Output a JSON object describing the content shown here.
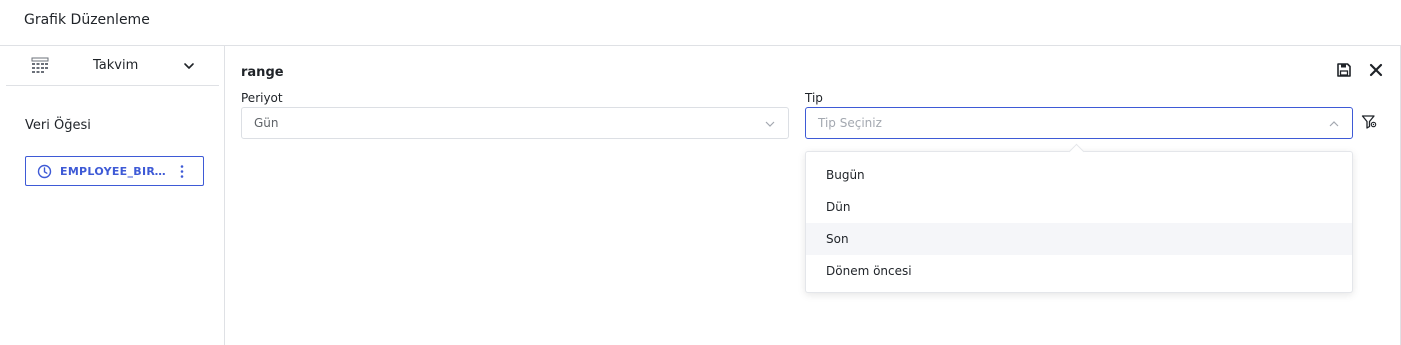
{
  "window": {
    "title": "Grafik Düzenleme"
  },
  "left_panel": {
    "chart_type": {
      "label": "Takvim",
      "icon": "calendar-grid-icon"
    },
    "section_title": "Veri Öğesi",
    "data_item": {
      "label": "EMPLOYEE_BIRTHDATE",
      "icon": "clock-icon",
      "color": "#3e5ad6"
    }
  },
  "editor": {
    "field_title": "range",
    "periyot": {
      "label": "Periyot",
      "value": "Gün"
    },
    "tip": {
      "label": "Tip",
      "placeholder": "Tip Seçiniz",
      "expanded": true,
      "options": [
        "Bugün",
        "Dün",
        "Son",
        "Dönem öncesi"
      ],
      "hovered": "Son"
    }
  },
  "colors": {
    "accent": "#3e5ad6",
    "border": "#dfe1e5",
    "hover": "#f5f6f9"
  }
}
